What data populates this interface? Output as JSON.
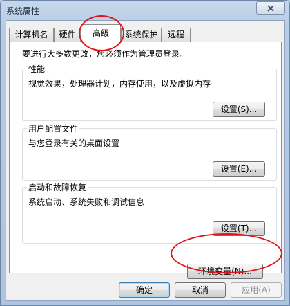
{
  "window": {
    "title": "系统属性"
  },
  "tabs": [
    {
      "label": "计算机名"
    },
    {
      "label": "硬件"
    },
    {
      "label": "高级"
    },
    {
      "label": "系统保护"
    },
    {
      "label": "远程"
    }
  ],
  "advanced": {
    "notice": "要进行大多数更改，您必须作为管理员登录。",
    "performance": {
      "title": "性能",
      "description": "视觉效果，处理器计划，内存使用，以及虚拟内存",
      "button": "设置(S)..."
    },
    "user_profiles": {
      "title": "用户配置文件",
      "description": "与您登录有关的桌面设置",
      "button": "设置(E)..."
    },
    "startup_recovery": {
      "title": "启动和故障恢复",
      "description": "系统启动、系统失败和调试信息",
      "button": "设置(T)..."
    },
    "env_vars_button": "环境变量(N)..."
  },
  "footer": {
    "ok": "确定",
    "cancel": "取消",
    "apply": "应用(A)"
  },
  "colors": {
    "highlight_ellipse": "#e0161b"
  }
}
